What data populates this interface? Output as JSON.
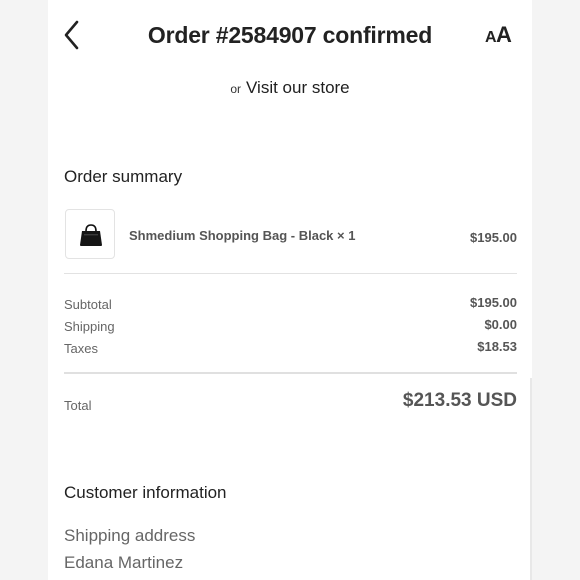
{
  "header": {
    "title": "Order #2584907 confirmed",
    "back_icon": "chevron-left-icon",
    "text_size_icon": "text-size-icon",
    "text_size_big": "A",
    "text_size_small": "A"
  },
  "store_line": {
    "prefix": "or",
    "link": "Visit our store"
  },
  "order_summary": {
    "title": "Order summary",
    "items": [
      {
        "name": "Shmedium Shopping Bag - Black × 1",
        "price": "$195.00",
        "image_icon": "black-bag-icon"
      }
    ],
    "subtotal": {
      "label": "Subtotal",
      "value": "$195.00"
    },
    "shipping": {
      "label": "Shipping",
      "value": "$0.00"
    },
    "taxes": {
      "label": "Taxes",
      "value": "$18.53"
    },
    "total": {
      "label": "Total",
      "value": "$213.53 USD"
    }
  },
  "customer_info": {
    "title": "Customer information",
    "shipping_address_label": "Shipping address",
    "name": "Edana Martinez"
  },
  "colors": {
    "background": "#f4f4f4",
    "sheet": "#ffffff",
    "text_primary": "#222222",
    "text_muted": "#666666"
  }
}
